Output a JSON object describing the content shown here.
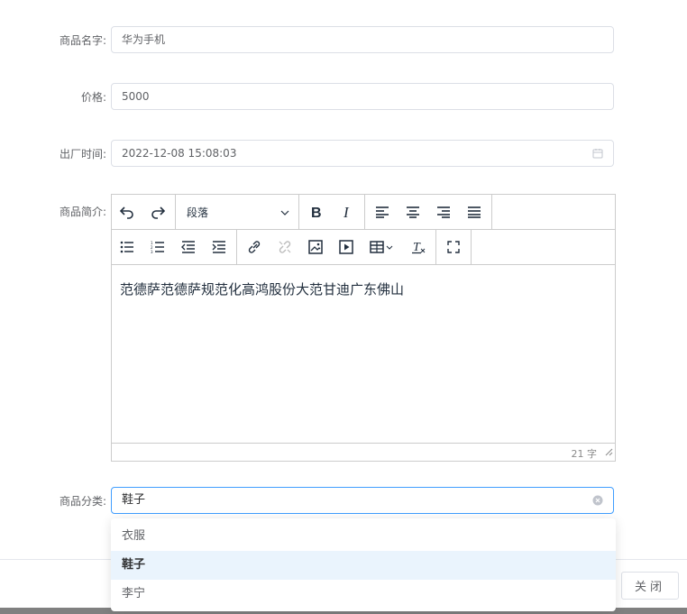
{
  "form": {
    "name": {
      "label": "商品名字:",
      "value": "华为手机"
    },
    "price": {
      "label": "价格:",
      "value": "5000"
    },
    "date": {
      "label": "出厂时间:",
      "value": "2022-12-08 15:08:03",
      "icon": "calendar-icon"
    },
    "desc": {
      "label": "商品简介:"
    },
    "category": {
      "label": "商品分类:",
      "value": "鞋子",
      "icon": "clear-icon"
    }
  },
  "editor": {
    "block_format": "段落",
    "content": "范德萨范德萨规范化高鸿股份大范甘迪广东佛山",
    "word_count": "21 字",
    "toolbar_row1": [
      "undo-icon",
      "redo-icon",
      "bold-icon",
      "italic-icon",
      "align-left-icon",
      "align-center-icon",
      "align-right-icon",
      "align-justify-icon"
    ],
    "toolbar_row2": [
      "bullet-list-icon",
      "numbered-list-icon",
      "outdent-icon",
      "indent-icon",
      "link-icon",
      "unlink-icon",
      "image-icon",
      "media-icon",
      "table-icon",
      "remove-format-icon",
      "fullscreen-icon"
    ]
  },
  "dropdown": {
    "options": [
      "衣服",
      "鞋子",
      "李宁"
    ],
    "selected_index": 1
  },
  "footer": {
    "close_label": "关闭"
  },
  "colors": {
    "accent": "#409eff",
    "selected_bg": "#eaf4fd",
    "border": "#dcdfe6"
  }
}
